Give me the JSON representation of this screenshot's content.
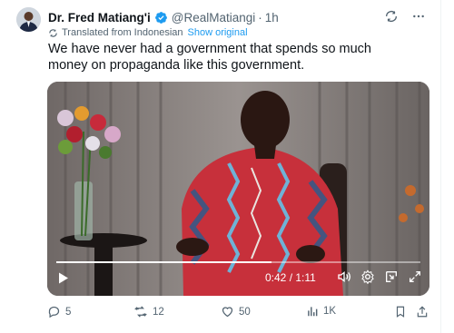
{
  "user": {
    "name": "Dr. Fred Matiang'i",
    "handle": "@RealMatiangi",
    "separator": "·",
    "time": "1h"
  },
  "translation": {
    "label": "Translated from Indonesian",
    "link": "Show original"
  },
  "tweet_text": "We have never had a government that spends so much money on propaganda like this government.",
  "video": {
    "time_display": "0:42 / 1:11",
    "progress": 0.59
  },
  "actions": {
    "replies": "5",
    "reposts": "12",
    "likes": "50",
    "views": "1K"
  },
  "colors": {
    "accent": "#1d9bf0",
    "muted": "#536471",
    "text": "#0f1419"
  },
  "icons": [
    "verified-badge-icon",
    "grok-icon",
    "more-icon",
    "translate-icon",
    "play-icon",
    "volume-icon",
    "settings-icon",
    "pip-icon",
    "fullscreen-icon",
    "reply-icon",
    "repost-icon",
    "like-icon",
    "views-icon",
    "bookmark-icon",
    "share-icon"
  ]
}
